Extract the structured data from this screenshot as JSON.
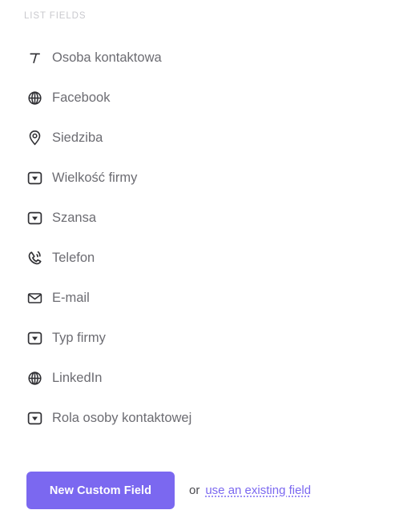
{
  "panel": {
    "section_title": "LIST FIELDS",
    "fields": [
      {
        "label": "Osoba kontaktowa",
        "icon": "text-field-icon"
      },
      {
        "label": "Facebook",
        "icon": "globe-icon"
      },
      {
        "label": "Siedziba",
        "icon": "map-pin-icon"
      },
      {
        "label": "Wielkość firmy",
        "icon": "dropdown-icon"
      },
      {
        "label": "Szansa",
        "icon": "dropdown-icon"
      },
      {
        "label": "Telefon",
        "icon": "phone-icon"
      },
      {
        "label": "E-mail",
        "icon": "envelope-icon"
      },
      {
        "label": "Typ firmy",
        "icon": "dropdown-icon"
      },
      {
        "label": "LinkedIn",
        "icon": "globe-icon"
      },
      {
        "label": "Rola osoby kontaktowej",
        "icon": "dropdown-icon"
      }
    ],
    "actions": {
      "new_custom_field_label": "New Custom Field",
      "or_label": "or",
      "existing_field_link": "use an existing field"
    },
    "colors": {
      "accent": "#7b68f0",
      "section_title": "#c9c9ce",
      "field_label": "#6c6c72",
      "icon": "#2f2f33",
      "background": "#ffffff"
    }
  }
}
